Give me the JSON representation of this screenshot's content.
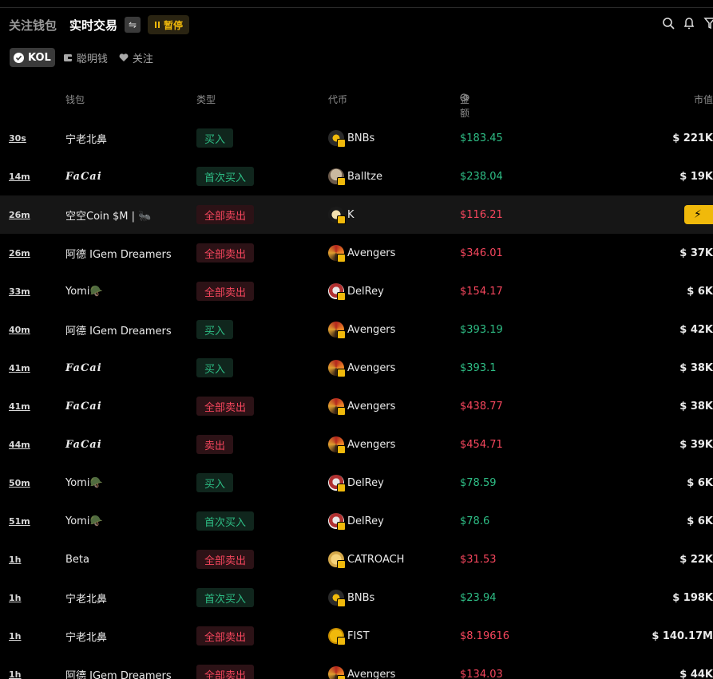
{
  "header": {
    "tab_follow": "关注钱包",
    "tab_live": "实时交易",
    "swap_glyph": "⇋",
    "pause_label": "暂停"
  },
  "filters": {
    "kol": "KOL",
    "smart": "聪明钱",
    "follow": "关注"
  },
  "columns": {
    "wallet": "钱包",
    "type": "类型",
    "token": "代币",
    "amount": "金额",
    "mcap": "市值"
  },
  "colors": {
    "buy": "#2ebd85",
    "sell": "#f6465d",
    "accent": "#f0b90b"
  },
  "rows": [
    {
      "time": "30s",
      "wallet": "宁老北鼻",
      "script": false,
      "type": "买入",
      "side": "buy",
      "token": "BNBs",
      "icon": "bnbs",
      "amount": "$183.45",
      "mcap": "$ 221K"
    },
    {
      "time": "14m",
      "wallet": "FaCai",
      "script": true,
      "type": "首次买入",
      "side": "buy",
      "token": "Balltze",
      "icon": "balltze",
      "amount": "$238.04",
      "mcap": "$ 19K"
    },
    {
      "time": "26m",
      "wallet": "空空Coin $M | 🐜",
      "script": false,
      "type": "全部卖出",
      "side": "sell",
      "token": "K",
      "icon": "k",
      "amount": "$116.21",
      "mcap": "",
      "highlight": true
    },
    {
      "time": "26m",
      "wallet": "阿德 IGem Dreamers",
      "script": false,
      "type": "全部卖出",
      "side": "sell",
      "token": "Avengers",
      "icon": "avengers",
      "amount": "$346.01",
      "mcap": "$ 37K"
    },
    {
      "time": "33m",
      "wallet": "Yomi🪖",
      "script": false,
      "type": "全部卖出",
      "side": "sell",
      "token": "DelRey",
      "icon": "delrey",
      "amount": "$154.17",
      "mcap": "$ 6K"
    },
    {
      "time": "40m",
      "wallet": "阿德 IGem Dreamers",
      "script": false,
      "type": "买入",
      "side": "buy",
      "token": "Avengers",
      "icon": "avengers",
      "amount": "$393.19",
      "mcap": "$ 42K"
    },
    {
      "time": "41m",
      "wallet": "FaCai",
      "script": true,
      "type": "买入",
      "side": "buy",
      "token": "Avengers",
      "icon": "avengers",
      "amount": "$393.1",
      "mcap": "$ 38K"
    },
    {
      "time": "41m",
      "wallet": "FaCai",
      "script": true,
      "type": "全部卖出",
      "side": "sell",
      "token": "Avengers",
      "icon": "avengers",
      "amount": "$438.77",
      "mcap": "$ 38K"
    },
    {
      "time": "44m",
      "wallet": "FaCai",
      "script": true,
      "type": "卖出",
      "side": "sell",
      "token": "Avengers",
      "icon": "avengers",
      "amount": "$454.71",
      "mcap": "$ 39K"
    },
    {
      "time": "50m",
      "wallet": "Yomi🪖",
      "script": false,
      "type": "买入",
      "side": "buy",
      "token": "DelRey",
      "icon": "delrey",
      "amount": "$78.59",
      "mcap": "$ 6K"
    },
    {
      "time": "51m",
      "wallet": "Yomi🪖",
      "script": false,
      "type": "首次买入",
      "side": "buy",
      "token": "DelRey",
      "icon": "delrey",
      "amount": "$78.6",
      "mcap": "$ 6K"
    },
    {
      "time": "1h",
      "wallet": "Beta",
      "script": false,
      "type": "全部卖出",
      "side": "sell",
      "token": "CATROACH",
      "icon": "catroach",
      "amount": "$31.53",
      "mcap": "$ 22K"
    },
    {
      "time": "1h",
      "wallet": "宁老北鼻",
      "script": false,
      "type": "首次买入",
      "side": "buy",
      "token": "BNBs",
      "icon": "bnbs",
      "amount": "$23.94",
      "mcap": "$ 198K"
    },
    {
      "time": "1h",
      "wallet": "宁老北鼻",
      "script": false,
      "type": "全部卖出",
      "side": "sell",
      "token": "FIST",
      "icon": "fist",
      "amount": "$8.19616",
      "mcap": "$ 140.17M"
    },
    {
      "time": "1h",
      "wallet": "阿德 IGem Dreamers",
      "script": false,
      "type": "全部卖出",
      "side": "sell",
      "token": "Avengers",
      "icon": "avengers",
      "amount": "$134.03",
      "mcap": "$ 44K"
    }
  ]
}
